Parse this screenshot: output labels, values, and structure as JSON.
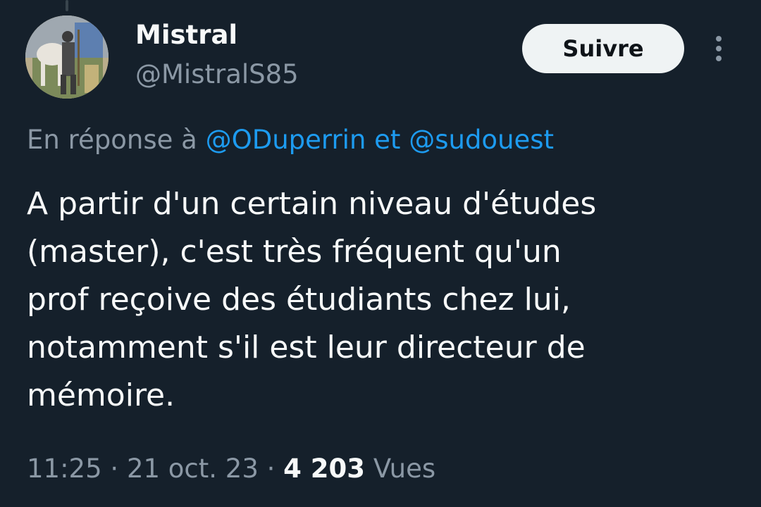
{
  "author": {
    "display_name": "Mistral",
    "handle": "@MistralS85"
  },
  "actions": {
    "follow_label": "Suivre",
    "more_icon": "more-vertical-icon"
  },
  "reply": {
    "prefix": "En réponse à",
    "mention_1": "@ODuperrin",
    "conjunction": "et",
    "mention_2": "@sudouest"
  },
  "tweet": {
    "lines": [
      "A partir d'un certain niveau d'études",
      "(master), c'est très fréquent qu'un",
      "prof reçoive des étudiants chez lui,",
      "notamment s'il est leur directeur de",
      "mémoire."
    ]
  },
  "meta": {
    "time": "11:25",
    "separator": "·",
    "date": "21 oct. 23",
    "views_count": "4 203",
    "views_label": "Vues"
  },
  "colors": {
    "background": "#15202b",
    "text_primary": "#f7f9f9",
    "text_secondary": "#8b98a5",
    "link": "#1d9bf0",
    "button_bg": "#eff3f4"
  }
}
